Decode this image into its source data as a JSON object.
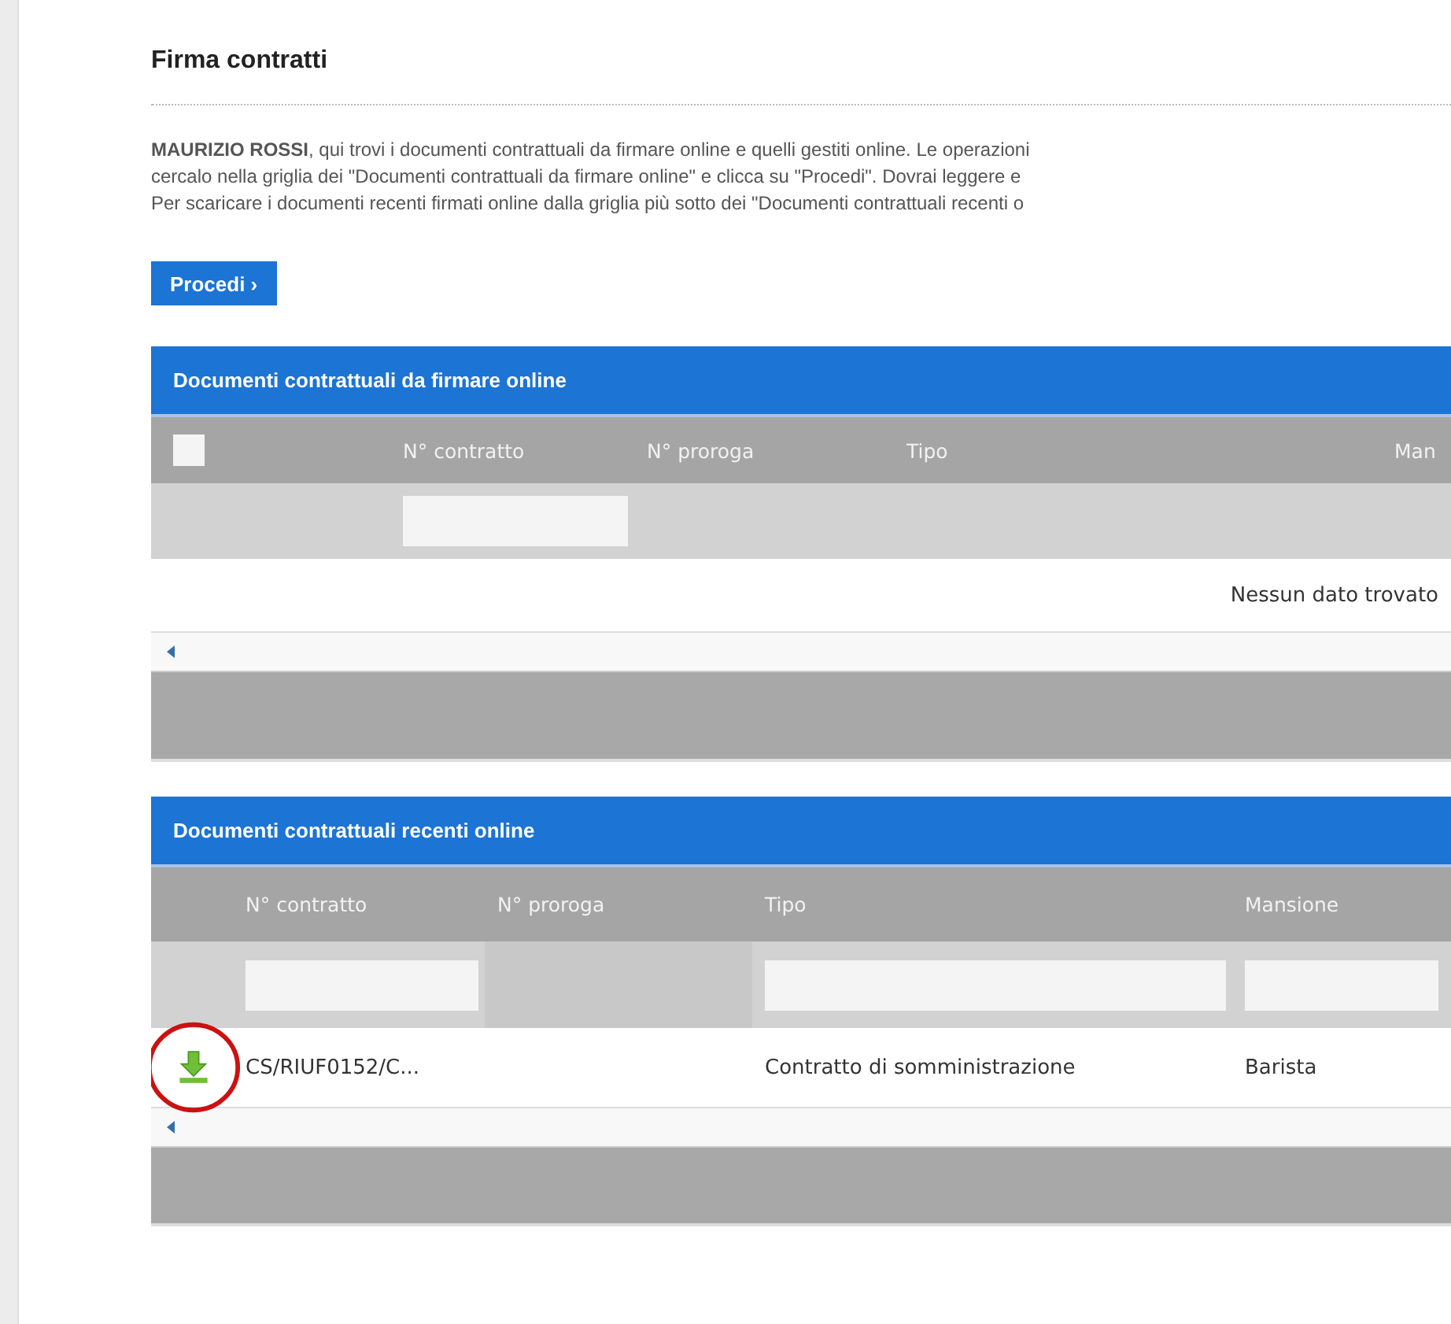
{
  "page": {
    "title": "Firma contratti",
    "intro": [
      "**MAURIZIO ROSSI**, qui trovi i documenti contrattuali da firmare online e quelli gestiti online. Le operazioni",
      "cercalo nella griglia dei \"Documenti contrattuali da firmare online\" e clicca su \"Procedi\". Dovrai leggere e",
      "Per scaricare i documenti recenti firmati online dalla griglia più sotto dei \"Documenti contrattuali recenti o"
    ],
    "button": {
      "label": "Procedi ›"
    }
  },
  "grids": [
    {
      "title": "Documenti contrattuali da firmare online",
      "columns": [
        {
          "kind": "checkbox",
          "checked": false
        },
        {
          "kind": "text",
          "label": "N° contratto"
        },
        {
          "kind": "text",
          "label": "N° proroga"
        },
        {
          "kind": "text",
          "label": "Tipo"
        },
        {
          "kind": "text",
          "label": "Man"
        }
      ],
      "filters": [
        {
          "kind": "none"
        },
        {
          "kind": "input"
        },
        {
          "kind": "none"
        },
        {
          "kind": "none"
        },
        {
          "kind": "none"
        }
      ],
      "empty_message": "Nessun dato trovato"
    },
    {
      "title": "Documenti contrattuali recenti online",
      "columns": [
        {
          "kind": "blank"
        },
        {
          "kind": "text",
          "label": "N° contratto"
        },
        {
          "kind": "text",
          "label": "N° proroga"
        },
        {
          "kind": "text",
          "label": "Tipo"
        },
        {
          "kind": "text",
          "label": "Mansione"
        }
      ],
      "filters": [
        {
          "kind": "none"
        },
        {
          "kind": "input"
        },
        {
          "kind": "disabled"
        },
        {
          "kind": "input"
        },
        {
          "kind": "input"
        }
      ],
      "rows": [
        {
          "cells": [
            {
              "kind": "download",
              "highlighted": true
            },
            {
              "kind": "text",
              "text": "CS/RIUF0152/C..."
            },
            {
              "kind": "empty"
            },
            {
              "kind": "text",
              "text": "Contratto di somministrazione"
            },
            {
              "kind": "text",
              "text": "Barista"
            }
          ]
        }
      ]
    }
  ]
}
